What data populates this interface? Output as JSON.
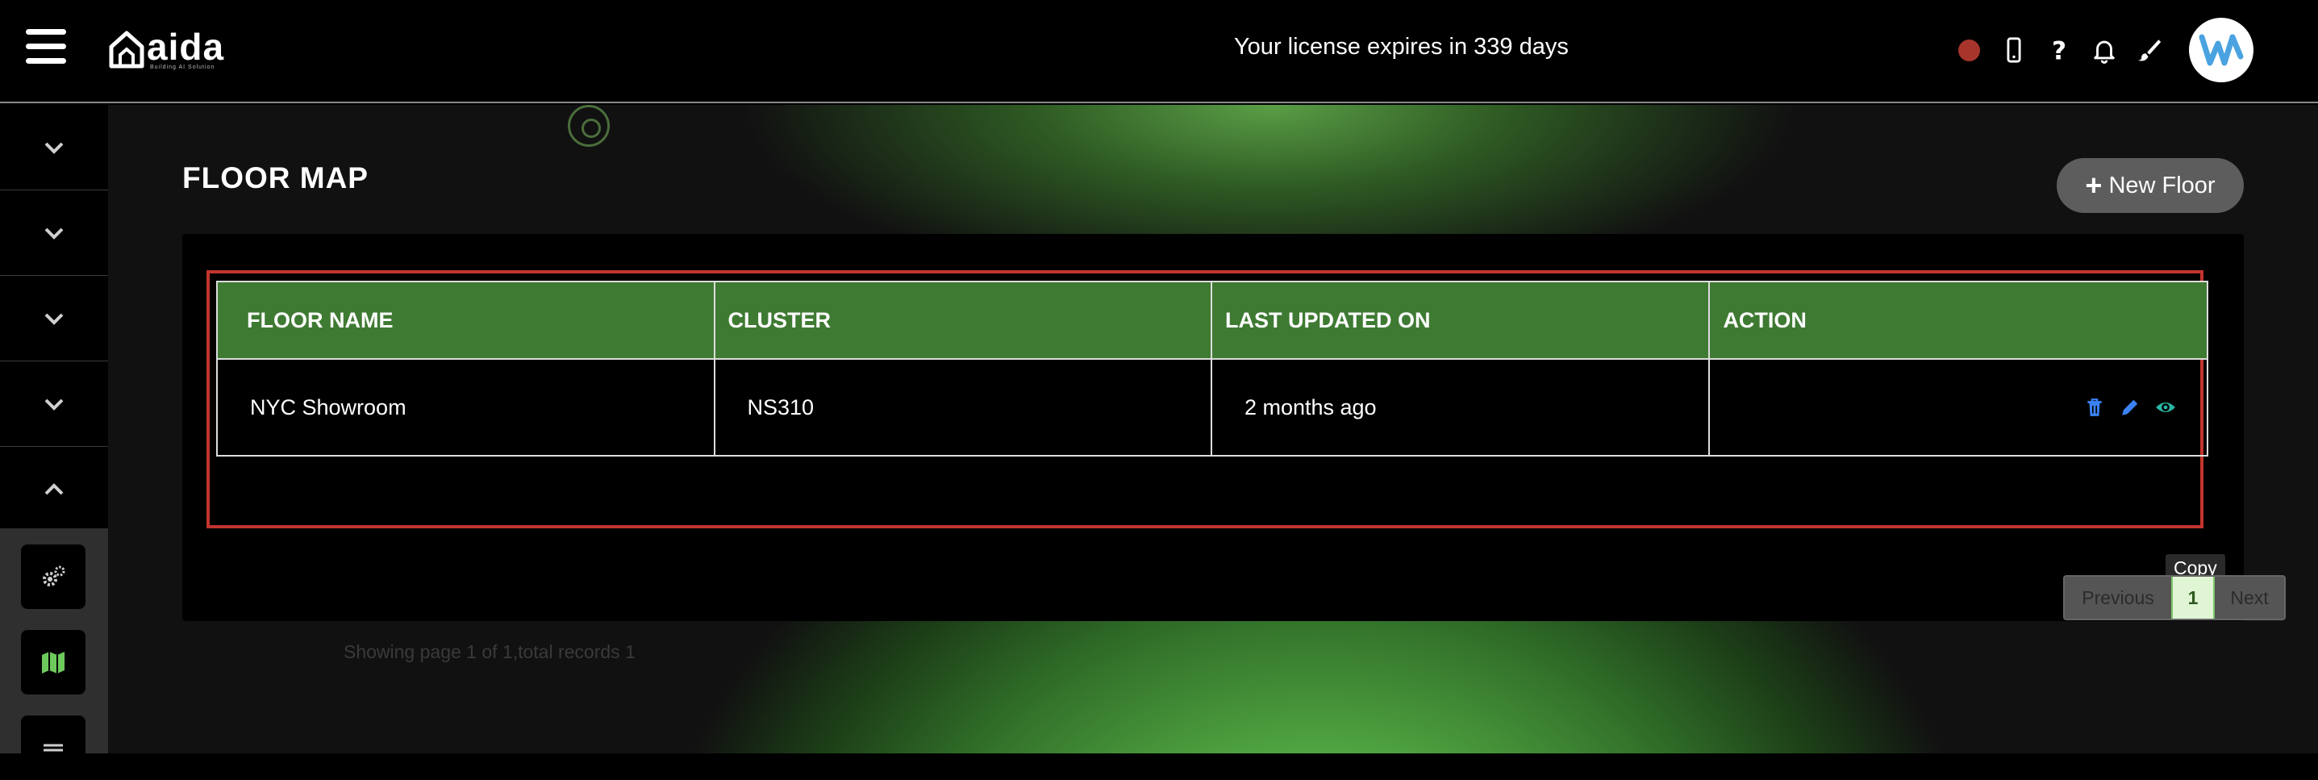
{
  "header": {
    "logo_text": "aida",
    "logo_tagline": "Building AI Solution",
    "license_text": "Your license expires in 339 days",
    "status_color": "#a8352b",
    "icons": [
      "status-dot-icon",
      "mobile-icon",
      "help-icon",
      "bell-icon",
      "brush-icon"
    ]
  },
  "sidebar": {
    "rows": [
      {
        "icon": "chevron-down-icon"
      },
      {
        "icon": "chevron-down-icon"
      },
      {
        "icon": "chevron-down-icon"
      },
      {
        "icon": "chevron-down-icon"
      },
      {
        "icon": "chevron-up-icon"
      }
    ],
    "tools": [
      "gears-icon",
      "map-icon",
      "tool-icon"
    ]
  },
  "main": {
    "title": "FLOOR MAP",
    "new_floor_label": "New Floor",
    "table": {
      "columns": [
        "FLOOR NAME",
        "CLUSTER",
        "LAST UPDATED ON",
        "ACTION"
      ],
      "rows": [
        {
          "floor_name": "NYC Showroom",
          "cluster": "NS310",
          "updated": "2 months ago"
        }
      ]
    },
    "tooltip": "Copy",
    "pagination": {
      "previous": "Previous",
      "current": "1",
      "next": "Next"
    },
    "showing_text": "Showing page 1 of 1,total records 1"
  },
  "colors": {
    "accent_green": "#3f7a33",
    "highlight_red": "#c2342c",
    "icon_blue": "#3b82f6",
    "icon_teal": "#2bb6a6"
  }
}
